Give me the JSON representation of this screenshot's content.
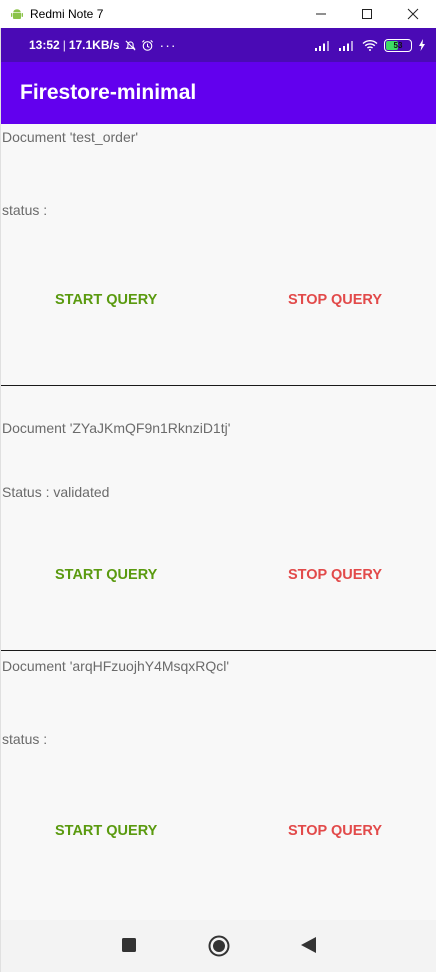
{
  "window": {
    "title": "Redmi Note 7"
  },
  "status_bar": {
    "time": "13:52",
    "separator": "|",
    "speed": "17.1KB/s",
    "more": "···",
    "battery": "53",
    "battery_level": 0.53
  },
  "app": {
    "title": "Firestore-minimal"
  },
  "sections": [
    {
      "document": "Document 'test_order'",
      "status": "status :",
      "start": "START QUERY",
      "stop": "STOP QUERY"
    },
    {
      "document": "Document 'ZYaJKmQF9n1RknziD1tj'",
      "status": "Status : validated",
      "start": "START QUERY",
      "stop": "STOP QUERY"
    },
    {
      "document": "Document 'arqHFzuojhY4MsqxRQcl'",
      "status": "status :",
      "start": "START QUERY",
      "stop": "STOP QUERY"
    }
  ],
  "colors": {
    "status_bar": "#4a0ab5",
    "app_bar": "#6200ee",
    "start": "#5a9a0f",
    "stop": "#e24a4a"
  }
}
